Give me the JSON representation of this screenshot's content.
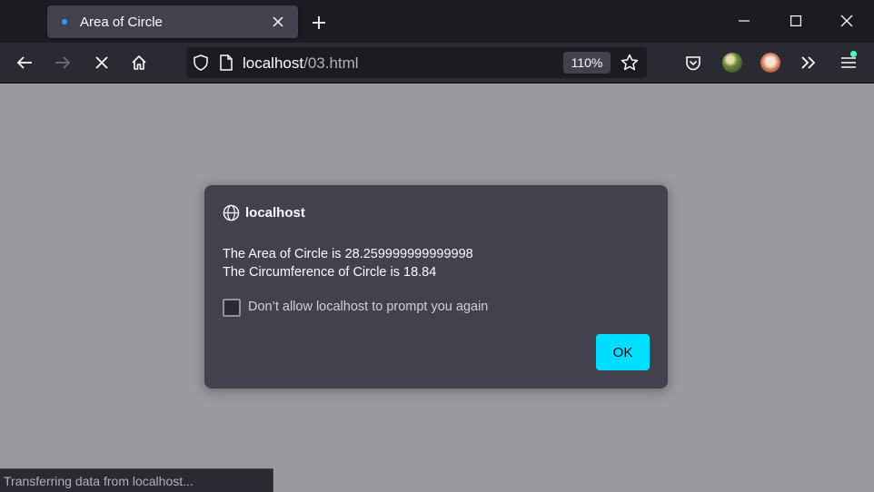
{
  "browser": {
    "tab": {
      "title": "Area of Circle"
    },
    "url": {
      "host": "localhost",
      "path": "/03.html"
    },
    "zoom": "110%",
    "icons": {
      "back": "back-arrow-icon",
      "forward": "forward-arrow-icon",
      "stop": "stop-icon",
      "home": "home-icon",
      "shield": "shield-icon",
      "page": "page-icon",
      "bookmark": "star-icon",
      "pocket": "pocket-icon",
      "overflow": "chevrons-right-icon",
      "menu": "hamburger-menu-icon"
    },
    "colors": {
      "accent": "#00ddff",
      "notification_dot": "#54ffbd",
      "tab_favicon": "#2aa0ff"
    }
  },
  "dialog": {
    "origin": "localhost",
    "message_lines": [
      "The Area of Circle is 28.259999999999998",
      "The Circumference of Circle is 18.84"
    ],
    "checkbox_label": "Don’t allow localhost to prompt you again",
    "checkbox_checked": false,
    "ok_label": "OK"
  },
  "status": {
    "text": "Transferring data from localhost..."
  }
}
